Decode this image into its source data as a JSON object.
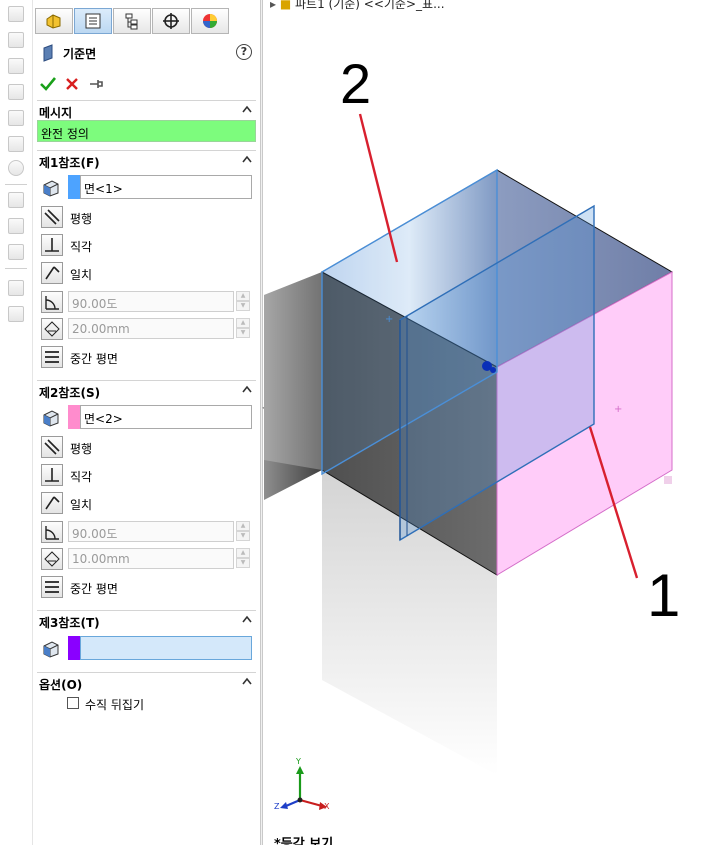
{
  "property_manager": {
    "title": "기준면",
    "help": "?",
    "tabs": [
      "feature-manager-icon",
      "property-manager-icon",
      "configuration-manager-icon",
      "dimxpert-icon",
      "display-manager-icon"
    ]
  },
  "sections": {
    "message": {
      "label": "메시지",
      "text": "완전 정의",
      "color": "#7dfc7d"
    },
    "first_reference": {
      "label": "제1참조(F)",
      "selection": "면<1>",
      "swatch_color": "#4da3ff",
      "options": {
        "parallel": "평행",
        "perpendicular": "직각",
        "coincident": "일치",
        "mid_plane": "중간 평면"
      },
      "angle": "90.00도",
      "distance": "20.00mm"
    },
    "second_reference": {
      "label": "제2참조(S)",
      "selection": "면<2>",
      "swatch_color": "#ff8ccd",
      "options": {
        "parallel": "평행",
        "perpendicular": "직각",
        "coincident": "일치",
        "mid_plane": "중간 평면"
      },
      "angle": "90.00도",
      "distance": "10.00mm"
    },
    "third_reference": {
      "label": "제3참조(T)",
      "selection": "",
      "swatch_color": "#8a00ff"
    },
    "options": {
      "label": "옵션(O)",
      "flip_normal": "수직 뒤집기",
      "flip_checked": false
    }
  },
  "viewport": {
    "tree_path": "파트1 (기준) <<기준>_표...",
    "view_name": "*등각 보기",
    "callouts": [
      "2",
      "1"
    ],
    "axis_labels": {
      "x": "X",
      "y": "Y",
      "z": "Z"
    },
    "colors": {
      "face_selected_1": "#ffccf9",
      "face_selected_2": "#8fa7d6",
      "plane_preview": "#4a8fd8",
      "callout_line": "#d8202f"
    }
  }
}
